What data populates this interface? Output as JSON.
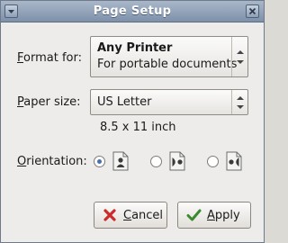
{
  "window": {
    "title": "Page Setup"
  },
  "format_for": {
    "label_prefix": "",
    "label_accel": "F",
    "label_rest": "ormat for:",
    "printer_name": "Any Printer",
    "printer_desc": "For portable documents"
  },
  "paper_size": {
    "label_accel": "P",
    "label_rest": "aper size:",
    "value": "US Letter",
    "dimensions": "8.5 x 11 inch"
  },
  "orientation": {
    "label_accel": "O",
    "label_rest": "rientation:",
    "selected": "portrait",
    "options": [
      "portrait",
      "landscape",
      "reverse-landscape"
    ]
  },
  "buttons": {
    "cancel_accel": "C",
    "cancel_rest": "ancel",
    "apply_accel": "A",
    "apply_rest": "pply"
  },
  "colors": {
    "titlebar": "#8fa0b8",
    "cancel_icon": "#cc2b2b",
    "apply_icon": "#3a8a2e"
  }
}
